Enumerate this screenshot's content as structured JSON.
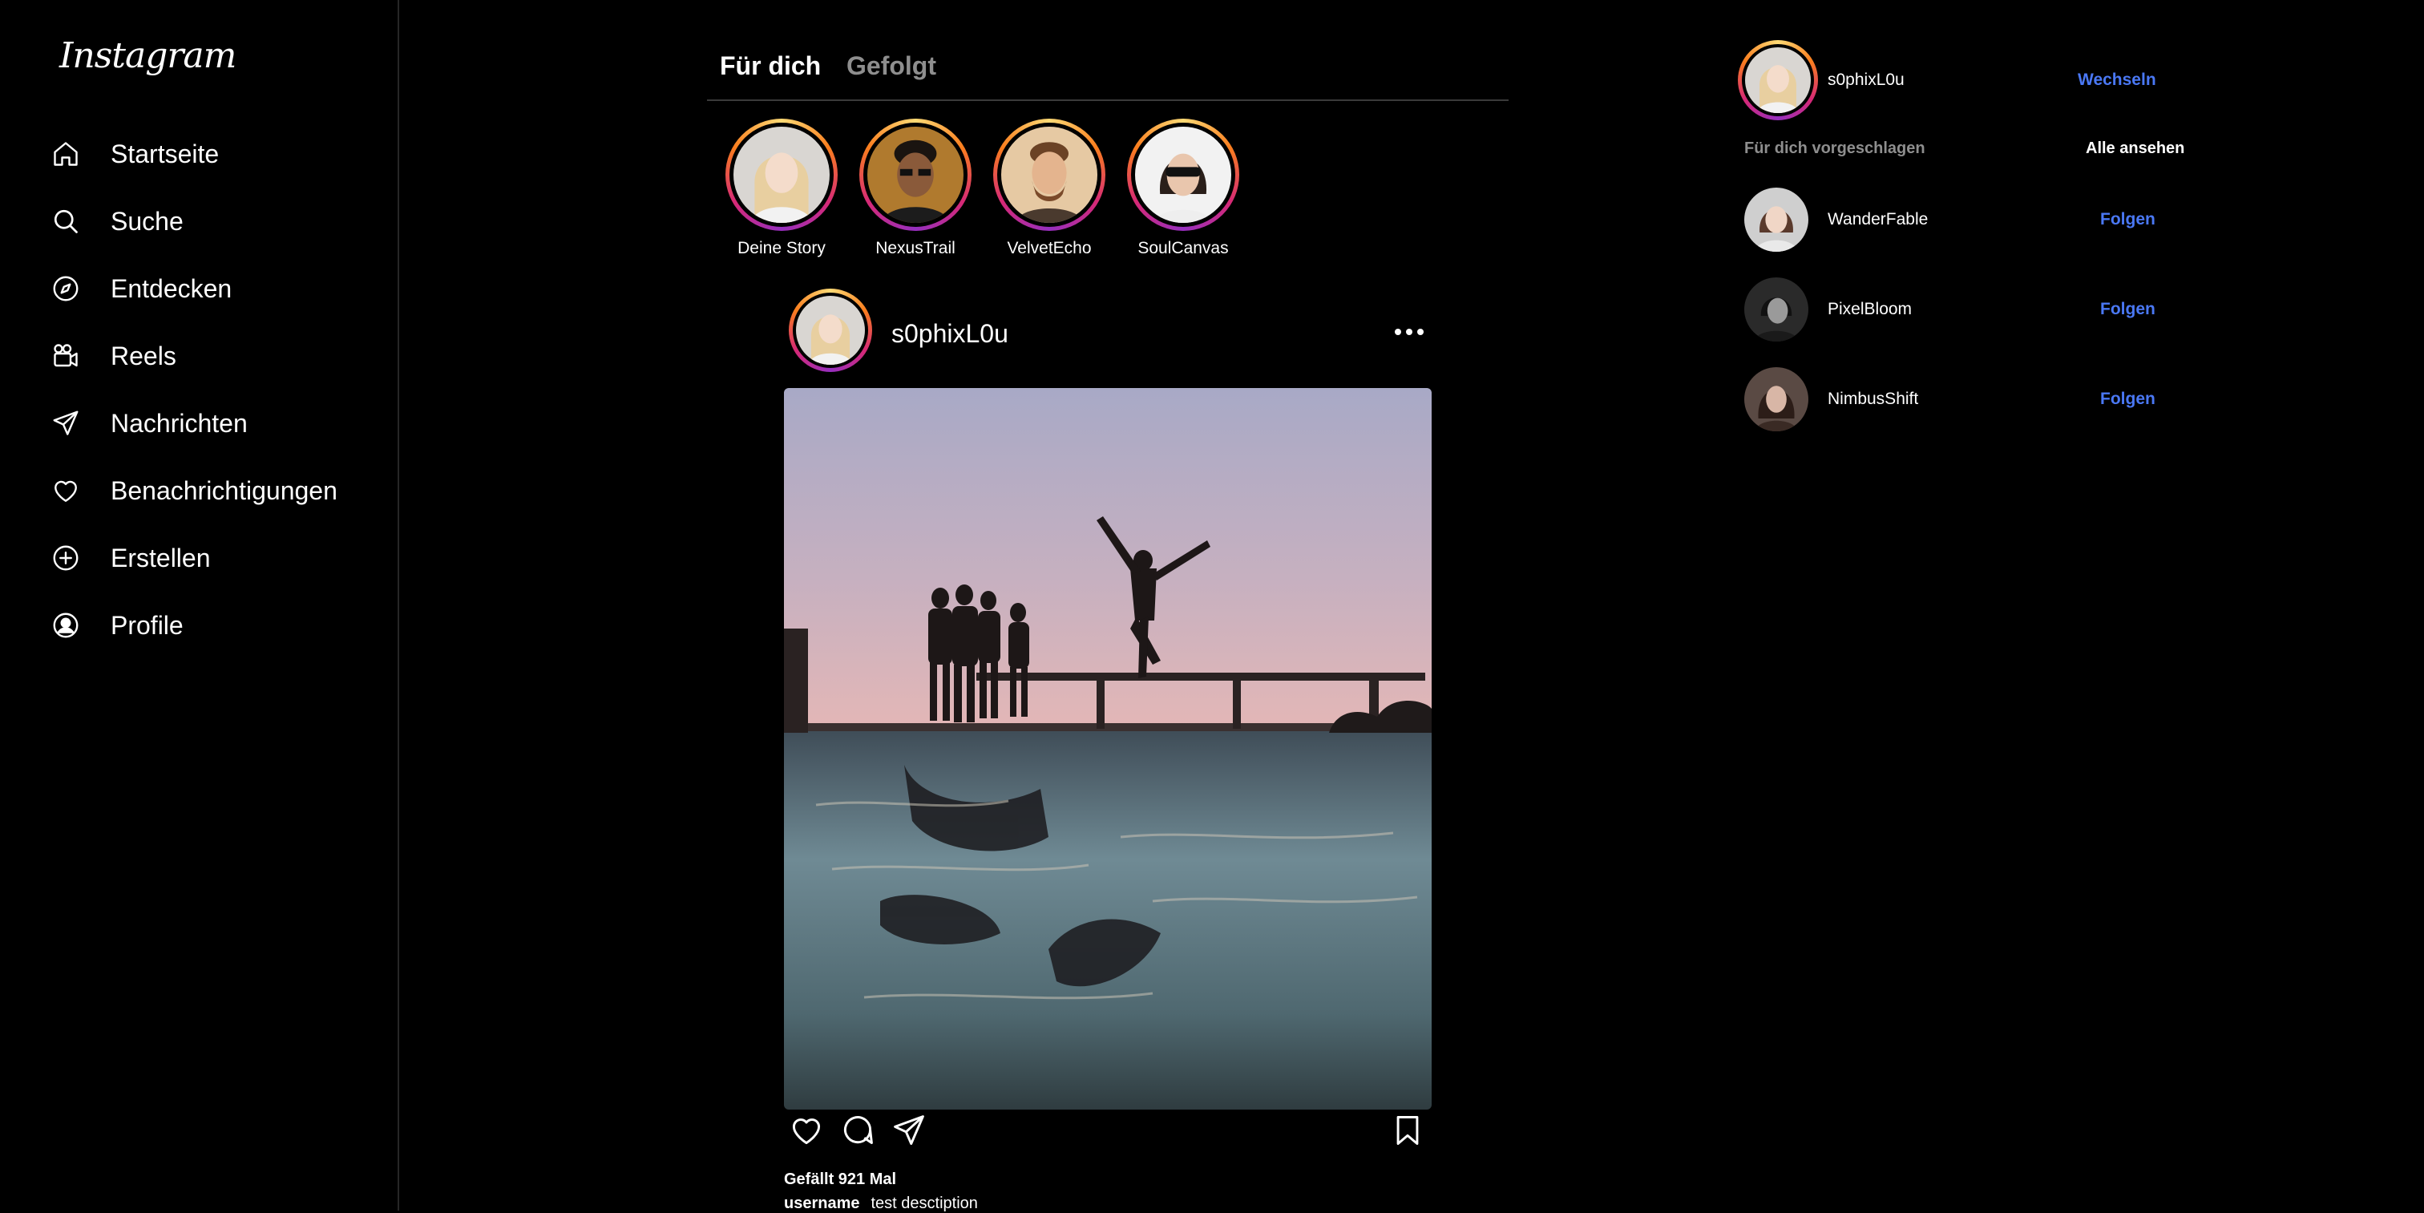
{
  "sidebar": {
    "logo": "Instagram",
    "items": [
      {
        "label": "Startseite",
        "icon": "home-icon"
      },
      {
        "label": "Suche",
        "icon": "search-icon"
      },
      {
        "label": "Entdecken",
        "icon": "compass-icon"
      },
      {
        "label": "Reels",
        "icon": "reels-icon"
      },
      {
        "label": "Nachrichten",
        "icon": "send-icon"
      },
      {
        "label": "Benachrichtigungen",
        "icon": "heart-icon"
      },
      {
        "label": "Erstellen",
        "icon": "plus-circle-icon"
      },
      {
        "label": "Profile",
        "icon": "profile-icon"
      }
    ]
  },
  "feed": {
    "tabs": [
      {
        "label": "Für dich",
        "active": true
      },
      {
        "label": "Gefolgt",
        "active": false
      }
    ],
    "stories": [
      {
        "name": "Deine Story"
      },
      {
        "name": "NexusTrail"
      },
      {
        "name": "VelvetEcho"
      },
      {
        "name": "SoulCanvas"
      }
    ],
    "post": {
      "username": "s0phixL0u",
      "likes": "Gefällt 921 Mal",
      "caption_user": "username",
      "caption_text": "test desctiption"
    }
  },
  "right": {
    "me": {
      "username": "s0phixL0u",
      "switch_label": "Wechseln"
    },
    "suggestions_title": "Für dich vorgeschlagen",
    "see_all": "Alle ansehen",
    "suggestions": [
      {
        "username": "WanderFable",
        "action": "Folgen"
      },
      {
        "username": "PixelBloom",
        "action": "Folgen"
      },
      {
        "username": "NimbusShift",
        "action": "Folgen"
      }
    ]
  },
  "colors": {
    "background": "#000000",
    "link_blue": "#4a78f5",
    "muted": "#8e8e8e",
    "divider": "#262626"
  }
}
